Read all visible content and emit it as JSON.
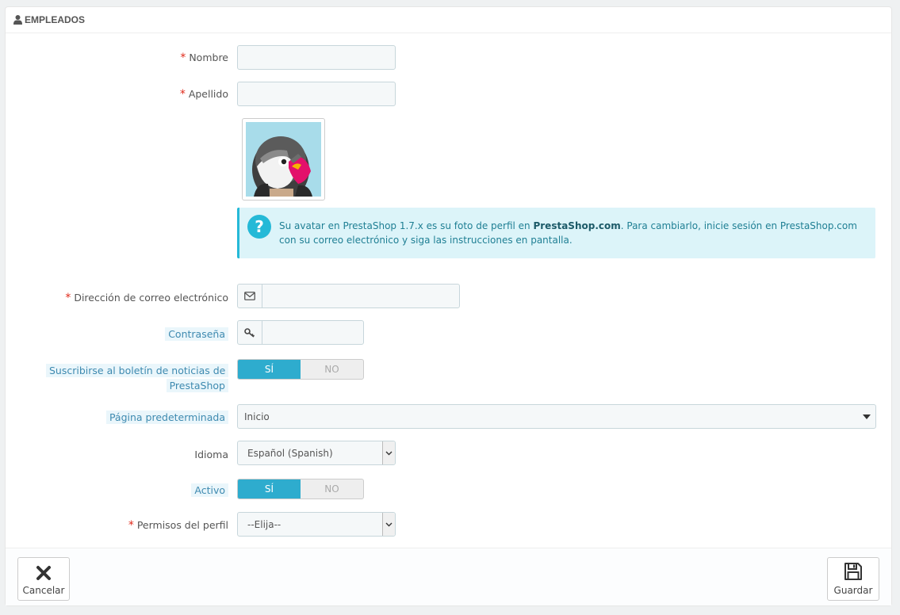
{
  "panel": {
    "title": "EMPLEADOS",
    "icon": "user-icon"
  },
  "form": {
    "first_name": {
      "label": "Nombre",
      "required": "*",
      "value": ""
    },
    "last_name": {
      "label": "Apellido",
      "required": "*",
      "value": ""
    },
    "avatar": {
      "icon": "prestashop-puffin-avatar"
    },
    "avatar_alert": {
      "icon": "question-icon",
      "text_1": "Su avatar en PrestaShop 1.7.x es su foto de perfil en ",
      "text_bold": "PrestaShop.com",
      "text_2": ". Para cambiarlo, inicie sesión en PrestaShop.com con su correo electrónico y siga las instrucciones en pantalla."
    },
    "email": {
      "label": "Dirección de correo electrónico",
      "required": "*",
      "value": "",
      "icon": "envelope-icon"
    },
    "password": {
      "label": "Contraseña",
      "value": "",
      "icon": "key-icon"
    },
    "newsletter": {
      "label": "Suscribirse al boletín de noticias de PrestaShop",
      "yes": "SÍ",
      "no": "NO",
      "selected": "SÍ"
    },
    "default_page": {
      "label": "Página predeterminada",
      "value": "Inicio"
    },
    "language": {
      "label": "Idioma",
      "value": "Español (Spanish)"
    },
    "active": {
      "label": "Activo",
      "yes": "SÍ",
      "no": "NO",
      "selected": "SÍ"
    },
    "profile": {
      "label": "Permisos del perfil",
      "required": "*",
      "value": "--Elija--"
    }
  },
  "footer": {
    "cancel": {
      "label": "Cancelar",
      "icon": "close-icon"
    },
    "save": {
      "label": "Guardar",
      "icon": "floppy-disk-icon"
    }
  },
  "colors": {
    "accent": "#2eacce",
    "required": "#e0291a",
    "alert_bg": "#dcf4f9"
  }
}
